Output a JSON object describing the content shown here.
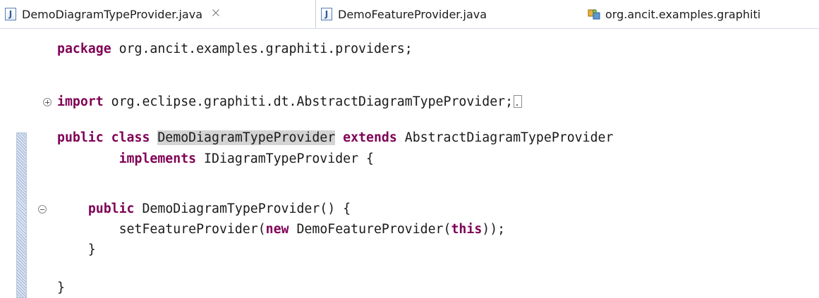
{
  "tabs": [
    {
      "label": "DemoDiagramTypeProvider.java",
      "icon": "java-file-icon",
      "active": true,
      "close_glyph": "⨉"
    },
    {
      "label": "DemoFeatureProvider.java",
      "icon": "java-file-icon",
      "active": false
    },
    {
      "label": "org.ancit.examples.graphiti",
      "icon": "plugin-manifest-icon",
      "active": false
    }
  ],
  "java_icon_letter": "J",
  "code": {
    "l1": {
      "kw": "package",
      "rest": " org.ancit.examples.graphiti.providers;"
    },
    "l2": {
      "kw": "import",
      "rest": " org.eclipse.graphiti.dt.AbstractDiagramTypeProvider;"
    },
    "l3": {
      "kw1": "public",
      "kw2": "class",
      "name": "DemoDiagramTypeProvider",
      "kw3": "extends",
      "rest": " AbstractDiagramTypeProvider"
    },
    "l4": {
      "indent": "        ",
      "kw": "implements",
      "rest": " IDiagramTypeProvider {"
    },
    "l5": {
      "indent": "    ",
      "kw": "public",
      "rest": " DemoDiagramTypeProvider() {"
    },
    "l6": {
      "prefix": "        setFeatureProvider(",
      "kw1": "new",
      "mid": " DemoFeatureProvider(",
      "kw2": "this",
      "suffix": "));"
    },
    "l7": {
      "text": "    }"
    },
    "l8": {
      "text": "}"
    }
  },
  "colors": {
    "keyword": "#7f0055",
    "highlight": "#d4d4d4",
    "range_indicator": "#9fb4d6"
  }
}
